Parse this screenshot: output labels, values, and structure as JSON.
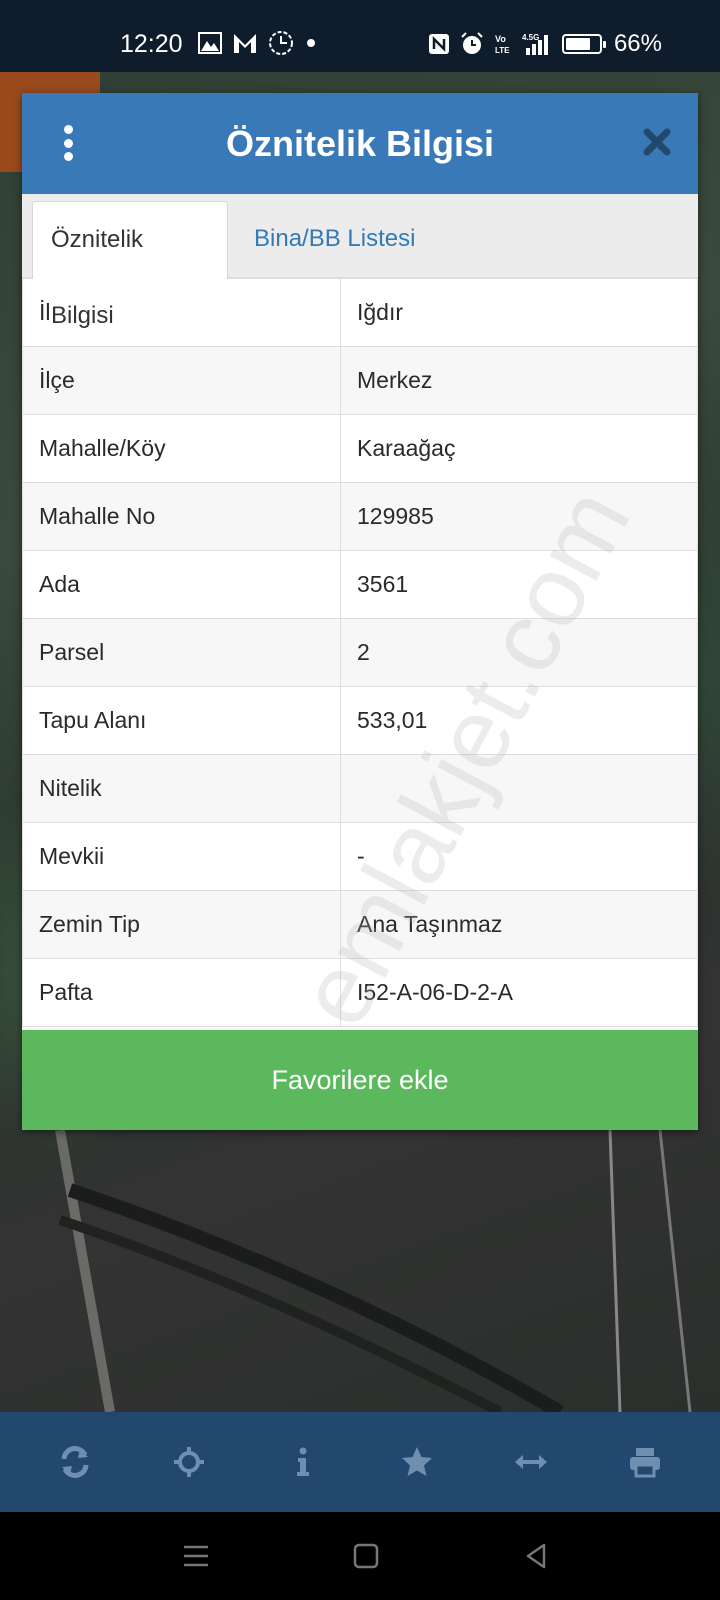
{
  "status_bar": {
    "time": "12:20",
    "battery_percent": "66%",
    "icons_left": [
      "gallery-icon",
      "gmail-icon",
      "clock-icon",
      "dot-icon"
    ],
    "icons_right": [
      "nfc-icon",
      "alarm-icon",
      "volte-icon",
      "signal-icon",
      "battery-icon"
    ]
  },
  "modal": {
    "title": "Öznitelik Bilgisi",
    "tabs": [
      {
        "label": "Öznitelik Bilgisi",
        "active": true
      },
      {
        "label": "Bina/BB Listesi",
        "active": false
      }
    ],
    "rows": [
      {
        "key": "İl",
        "value": "Iğdır"
      },
      {
        "key": "İlçe",
        "value": "Merkez"
      },
      {
        "key": "Mahalle/Köy",
        "value": "Karaağaç"
      },
      {
        "key": "Mahalle No",
        "value": "129985"
      },
      {
        "key": "Ada",
        "value": "3561"
      },
      {
        "key": "Parsel",
        "value": "2"
      },
      {
        "key": "Tapu Alanı",
        "value": "533,01"
      },
      {
        "key": "Nitelik",
        "value": ""
      },
      {
        "key": "Mevkii",
        "value": "-"
      },
      {
        "key": "Zemin Tip",
        "value": "Ana Taşınmaz"
      },
      {
        "key": "Pafta",
        "value": "I52-A-06-D-2-A"
      }
    ],
    "favorite_button": "Favorilere ekle"
  },
  "watermark": "emlakjet.com",
  "toolbar": {
    "buttons": [
      "refresh-icon",
      "crosshair-icon",
      "info-icon",
      "star-icon",
      "measure-icon",
      "print-icon"
    ]
  },
  "navbar": {
    "buttons": [
      "menu-icon",
      "home-icon",
      "back-icon"
    ]
  },
  "colors": {
    "header": "#3a79b7",
    "favorite": "#5cb85c",
    "toolbar": "#23486e",
    "tab_link": "#337ab7"
  }
}
